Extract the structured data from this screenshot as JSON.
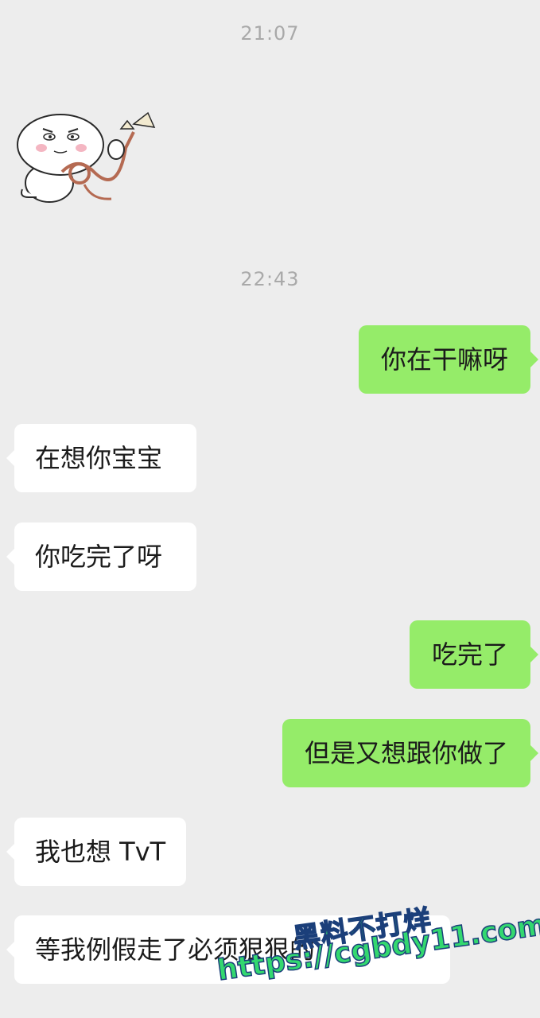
{
  "chat": {
    "timestamps": [
      "21:07",
      "22:43"
    ],
    "messages": [
      {
        "side": "out",
        "text": "你在干嘛呀"
      },
      {
        "side": "in",
        "text": "在想你宝宝"
      },
      {
        "side": "in",
        "text": "你吃完了呀"
      },
      {
        "side": "out",
        "text": "吃完了"
      },
      {
        "side": "out",
        "text": "但是又想跟你做了"
      },
      {
        "side": "in",
        "text": "我也想 TvT"
      },
      {
        "side": "in",
        "text": "等我例假走了必须狠狠的"
      }
    ]
  },
  "sticker": {
    "icon": "cartoon-bunny-with-rope-sticker"
  },
  "watermark": {
    "line1": "黑料不打烊",
    "line2": "https://cgbdy11.com"
  },
  "colors": {
    "background": "#ededed",
    "incoming_bubble": "#ffffff",
    "outgoing_bubble": "#95ec69",
    "timestamp": "#a9a9a9"
  }
}
